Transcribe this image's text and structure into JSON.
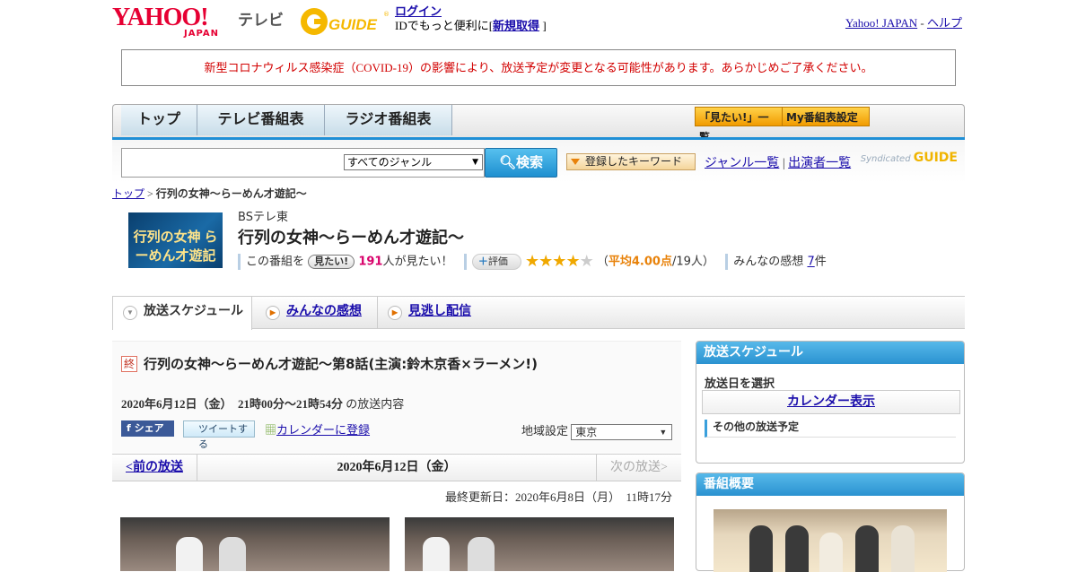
{
  "header": {
    "yahoo_logo": "YAHOO!",
    "japan_text": "JAPAN",
    "tv_label": "テレビ",
    "gguide_logo": "GUIDE",
    "login_link": "ログイン",
    "login_sub_prefix": "IDでもっと便利に[",
    "register_link": "新規取得",
    "login_sub_suffix": "]",
    "yahoo_japan_link": "Yahoo! JAPAN",
    "separator": "-",
    "help_link": "ヘルプ"
  },
  "notice": "新型コロナウィルス感染症（COVID-19）の影響により、放送予定が変更となる可能性があります。あらかじめご了承ください。",
  "nav": {
    "tabs": [
      "トップ",
      "テレビ番組表",
      "ラジオ番組表"
    ],
    "mitai_list": "「見たい!」一覧",
    "my_schedule": "My番組表設定"
  },
  "search": {
    "input_value": "",
    "genre_selected": "すべてのジャンル",
    "search_button": "検索",
    "keyword_button": "登録したキーワード",
    "genre_link": "ジャンル一覧",
    "link_separator": "|",
    "cast_link": "出演者一覧",
    "syndicated": "Syndicated",
    "syndicated_logo": "GUIDE"
  },
  "breadcrumb": {
    "top": "トップ",
    "sep": ">",
    "current": "行列の女神～らーめん才遊記～"
  },
  "program": {
    "thumb_text": "行列の女神 らーめん才遊記",
    "channel": "BSテレ東",
    "title": "行列の女神～らーめん才遊記～",
    "mitai_prefix": "この番組を",
    "mitai_button": "見たい!",
    "mitai_count": "191",
    "mitai_suffix": "人が見たい！",
    "rating_label": "評価",
    "stars_filled": "★★★★",
    "stars_empty": "★",
    "rating_open": "（",
    "rating_avg": "平均4.00点",
    "rating_count": "/19人）",
    "rating_value": 4.0,
    "impression_label": "みんなの感想",
    "impression_count": "7",
    "impression_suffix": "件"
  },
  "tabs": [
    "放送スケジュール",
    "みんなの感想",
    "見逃し配信"
  ],
  "episode": {
    "badge": "終",
    "title": "行列の女神～らーめん才遊記～第8話(主演:鈴木京香×ラーメン!)",
    "date_time": "2020年6月12日（金）　21時00分～21時54分",
    "date_suffix": "の放送内容",
    "share_button": "シェア",
    "tweet_button": "ツイートする",
    "calendar_link": "カレンダーに登録",
    "region_label": "地域設定",
    "region_value": "東京"
  },
  "pager": {
    "prev": "<前の放送",
    "date": "2020年6月12日（金）",
    "next": "次の放送>"
  },
  "last_updated": "最終更新日：2020年6月8日（月）　11時17分",
  "sidebar": {
    "schedule_header": "放送スケジュール",
    "select_date": "放送日を選択",
    "calendar_button": "カレンダー表示",
    "other_schedule": "その他の放送予定",
    "summary_header": "番組概要"
  },
  "colors": {
    "accent_blue": "#1f8fd6",
    "notice_red": "#d20000",
    "yahoo_red": "#e60033",
    "star_gold": "#f0a800",
    "pink_count": "#d8006a"
  }
}
